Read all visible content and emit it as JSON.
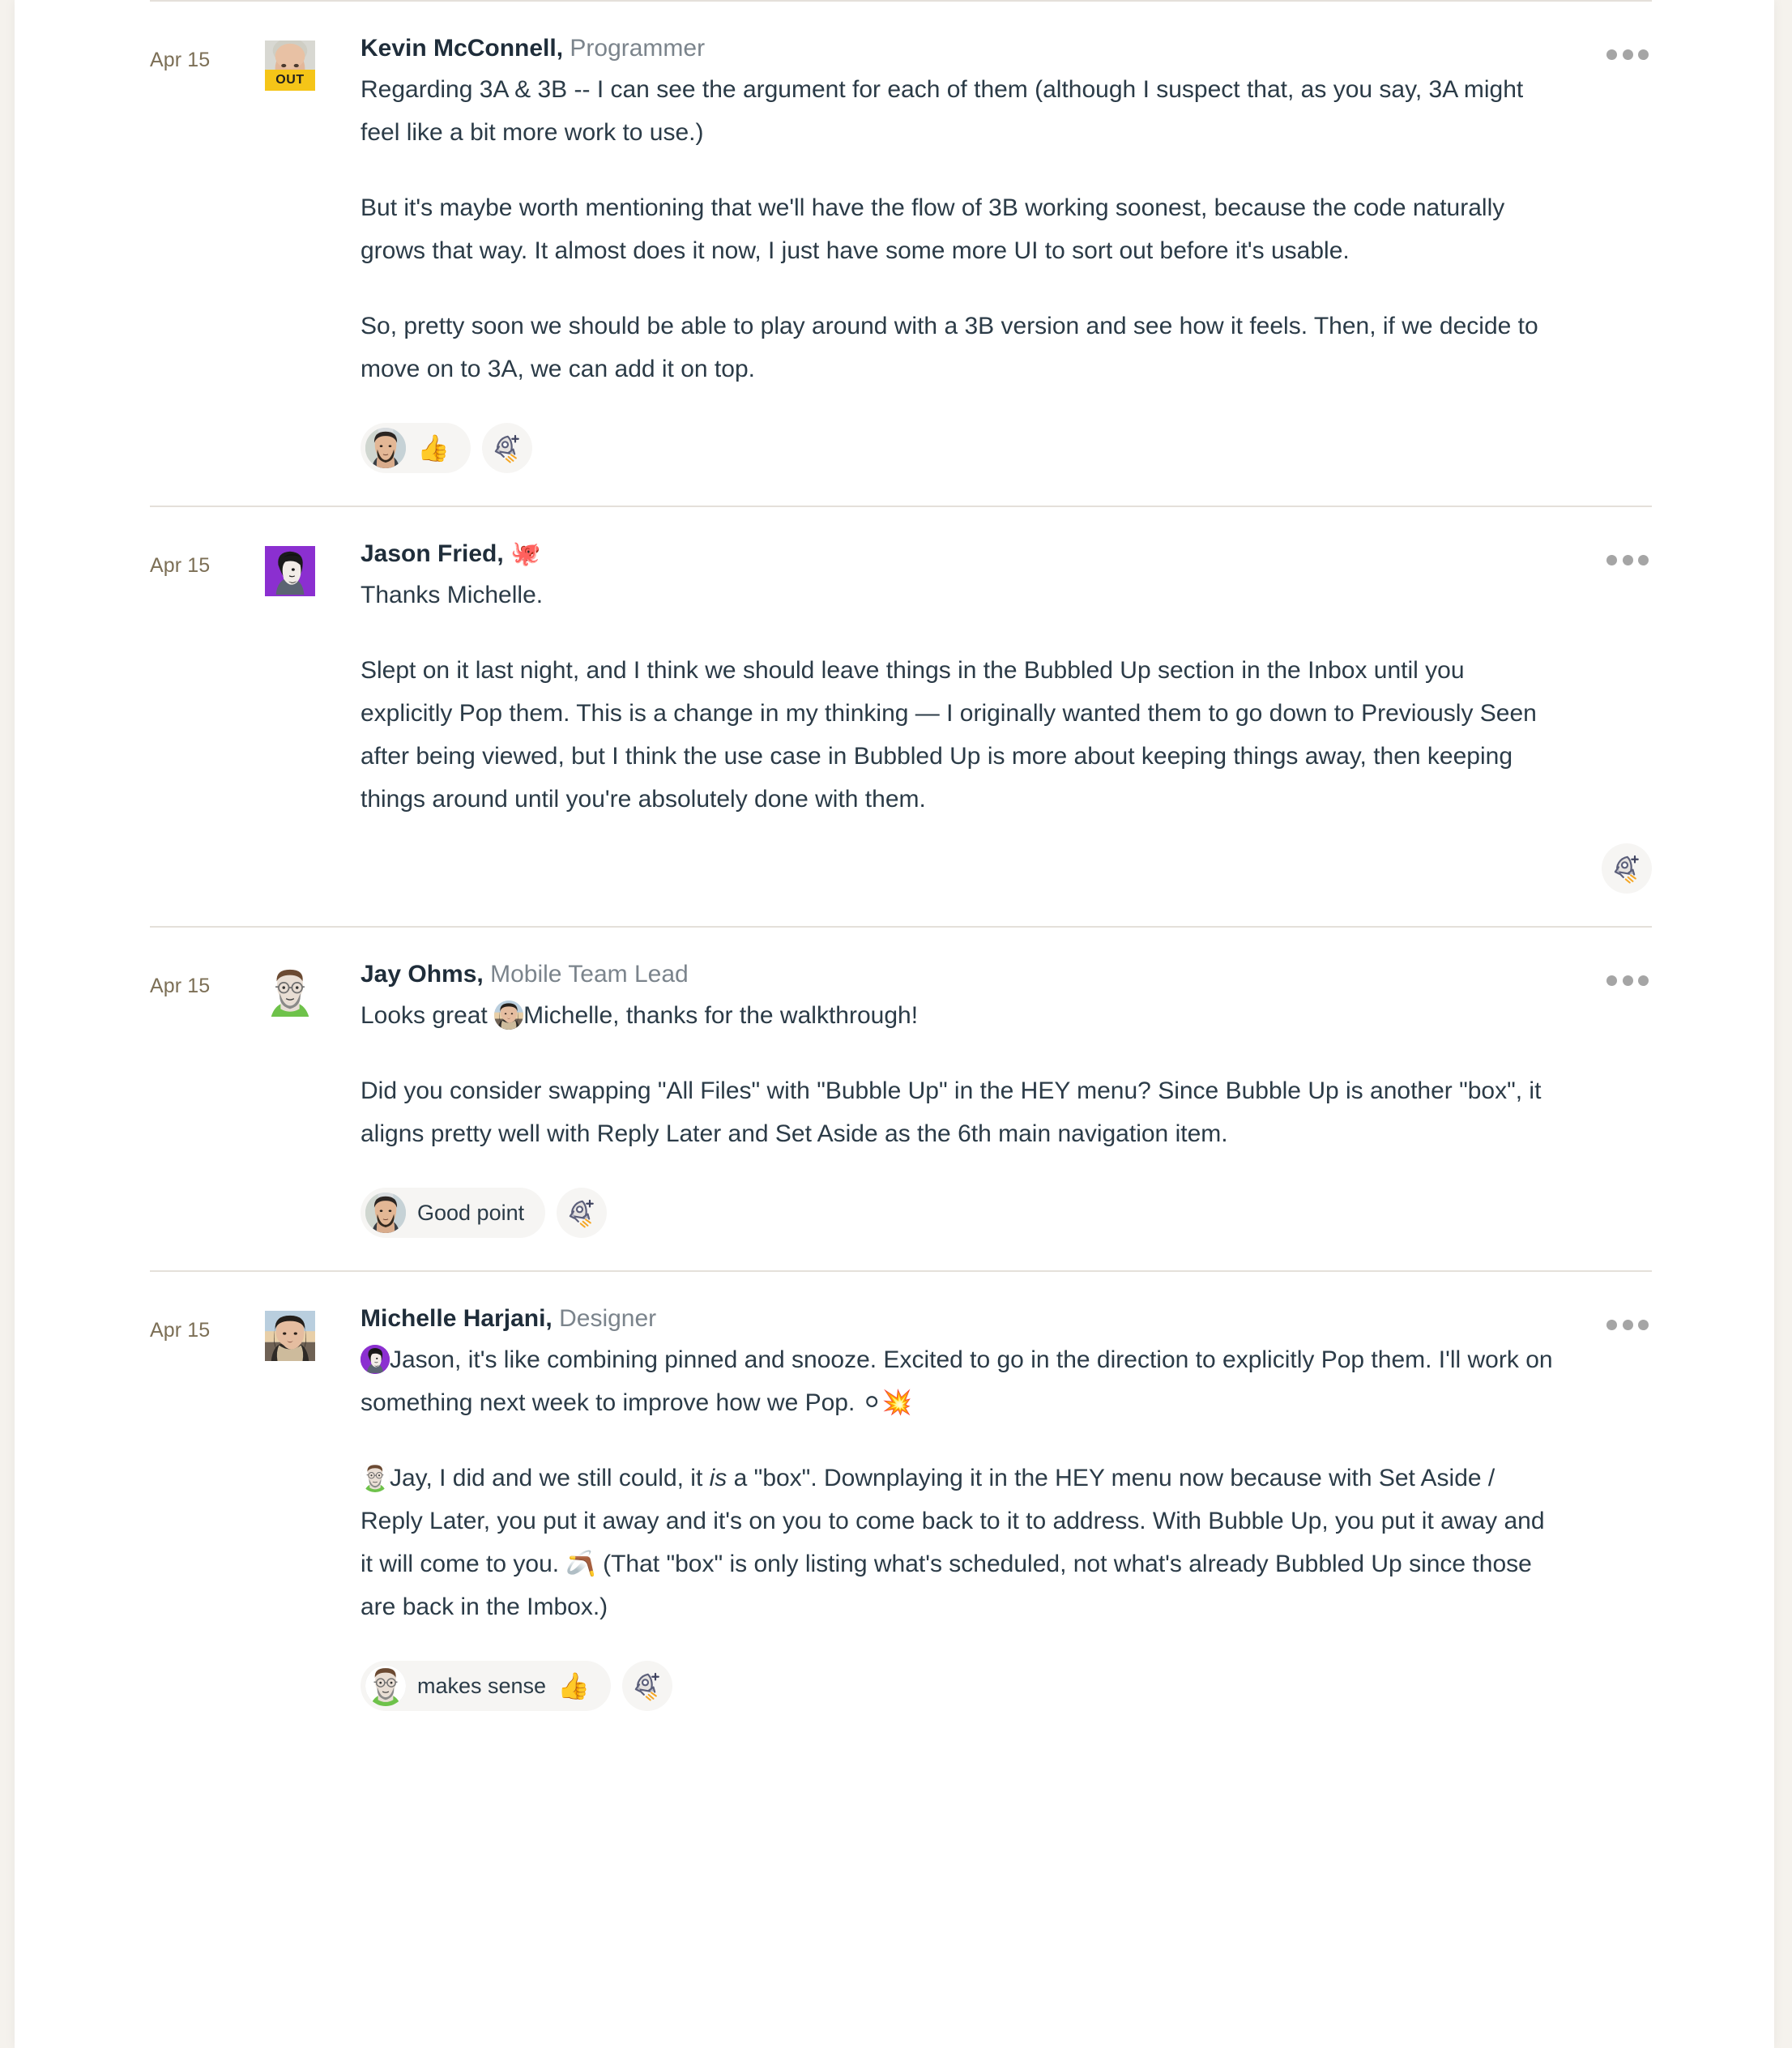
{
  "theme": {
    "page_background": "#f5f2ed",
    "card_background": "#ffffff",
    "divider": "#e4e0da",
    "date_color": "#7c6f56",
    "author_color": "#1f2d3a",
    "role_color": "#7b848c",
    "body_color": "#2b3b47",
    "pill_background": "#f6f5f3",
    "out_badge": "#f5c518"
  },
  "icons": {
    "more": "ellipsis-icon",
    "add_reaction": "rocket-plus-icon"
  },
  "messages": [
    {
      "date": "Apr 15",
      "author": "Kevin McConnell,",
      "role": "Programmer",
      "role_emoji": "",
      "avatar": "kevin",
      "status_badge": "OUT",
      "paragraphs": [
        "Regarding 3A & 3B -- I can see the argument for each of them (although I suspect that, as you say, 3A might feel like a bit more work to use.)",
        "But it's maybe worth mentioning that we'll have the flow of 3B working soonest, because the code naturally grows that way. It almost does it now, I just have some more UI to sort out before it's usable.",
        "So, pretty soon we should be able to play around with a 3B version and see how it feels. Then, if we decide to move on to 3A, we can add it on top."
      ],
      "reactions": [
        {
          "avatar": "reactor-dark",
          "text": "",
          "emoji": "👍"
        }
      ],
      "add_reaction_label": "Add a reaction",
      "add_reaction_align": "left",
      "more_label": "More options"
    },
    {
      "date": "Apr 15",
      "author": "Jason Fried,",
      "role": "",
      "role_emoji": "🐙",
      "avatar": "jason",
      "status_badge": "",
      "paragraphs": [
        "Thanks Michelle.",
        "Slept on it last night, and I think we should leave things in the Bubbled Up section in the Inbox until you explicitly Pop them. This is a change in my thinking — I originally wanted them to go down to Previously Seen after being viewed, but I think the use case in Bubbled Up is more about keeping things away, then keeping things around until you're absolutely done with them."
      ],
      "reactions": [],
      "add_reaction_label": "Add a reaction",
      "add_reaction_align": "right",
      "more_label": "More options"
    },
    {
      "date": "Apr 15",
      "author": "Jay Ohms,",
      "role": "Mobile Team Lead",
      "role_emoji": "",
      "avatar": "jay",
      "status_badge": "",
      "paragraphs": [
        "Did you consider swapping \"All Files\" with \"Bubble Up\" in the HEY menu? Since Bubble Up is another \"box\", it aligns pretty well with Reply Later and Set Aside as the 6th main navigation item."
      ],
      "first_paragraph_pre": "Looks great ",
      "first_paragraph_mention_avatar": "michelle",
      "first_paragraph_post": "Michelle, thanks for the walkthrough!",
      "reactions": [
        {
          "avatar": "reactor-dark",
          "text": "Good point",
          "emoji": ""
        }
      ],
      "add_reaction_label": "Add a reaction",
      "add_reaction_align": "left",
      "more_label": "More options"
    },
    {
      "date": "Apr 15",
      "author": "Michelle Harjani,",
      "role": "Designer",
      "role_emoji": "",
      "avatar": "michelle",
      "status_badge": "",
      "paragraphs": [],
      "rich_paragraphs": [
        {
          "mention_avatar": "jason",
          "pre": "",
          "text": "Jason, it's like combining pinned and snooze. Excited to go in the direction to explicitly Pop them. I'll work on something next week to improve how we Pop. ",
          "trailing_emoji": "⚪💥"
        },
        {
          "mention_avatar": "jay",
          "pre": " ",
          "text_a": "Jay, I did and we still could, it ",
          "italic": "is",
          "text_b": " a \"box\". Downplaying it in the HEY menu now because with Set Aside / Reply Later, you put it away and it's on you to come back to it to address. With Bubble Up, you put it away and it will come to you. ",
          "mid_emoji": "🪃",
          "text_c": " (That \"box\" is only listing what's scheduled, not what's already Bubbled Up since those are back in the Imbox.)"
        }
      ],
      "reactions": [
        {
          "avatar": "jay",
          "text": "makes sense",
          "emoji": "👍"
        }
      ],
      "add_reaction_label": "Add a reaction",
      "add_reaction_align": "left",
      "more_label": "More options"
    }
  ]
}
